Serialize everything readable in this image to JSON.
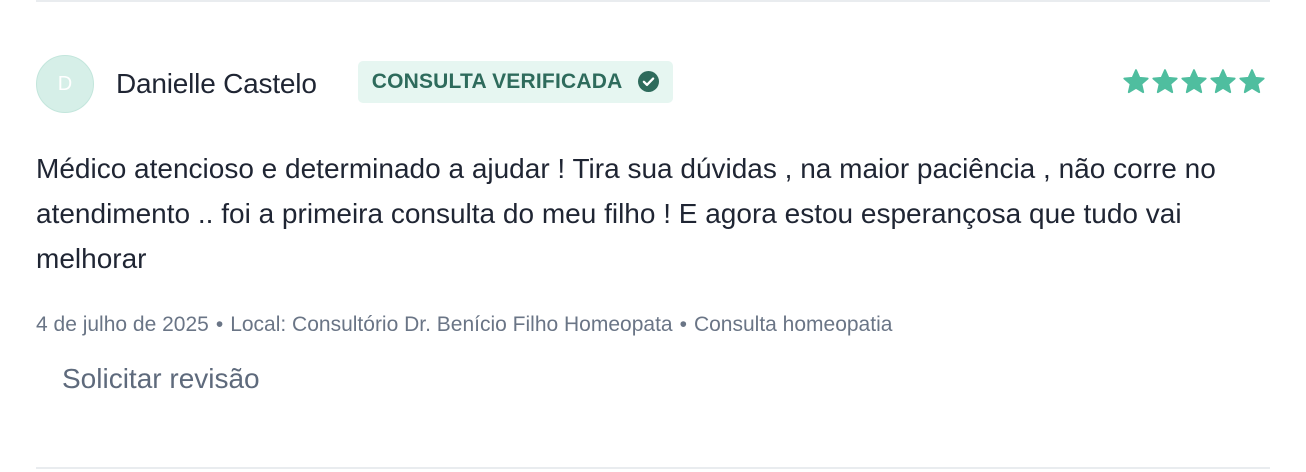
{
  "review": {
    "author": {
      "initial": "D",
      "name": "Danielle Castelo"
    },
    "badge": {
      "label": "CONSULTA VERIFICADA",
      "icon": "check-circle-icon"
    },
    "rating": {
      "value": 5,
      "max": 5,
      "icon": "star-icon"
    },
    "text": "Médico atencioso e determinado a ajudar ! Tira sua dúvidas , na maior paciência , não corre no atendimento .. foi a primeira consulta do meu filho ! E agora estou esperançosa que tudo vai melhorar",
    "meta": {
      "date": "4 de julho de 2025",
      "separator": "•",
      "location": "Local: Consultório Dr. Benício Filho Homeopata",
      "service": "Consulta homeopatia"
    },
    "action": {
      "request_review_label": "Solicitar revisão"
    }
  },
  "colors": {
    "accent": "#4fbe9f",
    "badge_bg": "#e6f6f1",
    "badge_text": "#2e6b5c",
    "avatar_bg": "#d6efe8",
    "muted_text": "#6a7586",
    "body_text": "#1f2533"
  }
}
